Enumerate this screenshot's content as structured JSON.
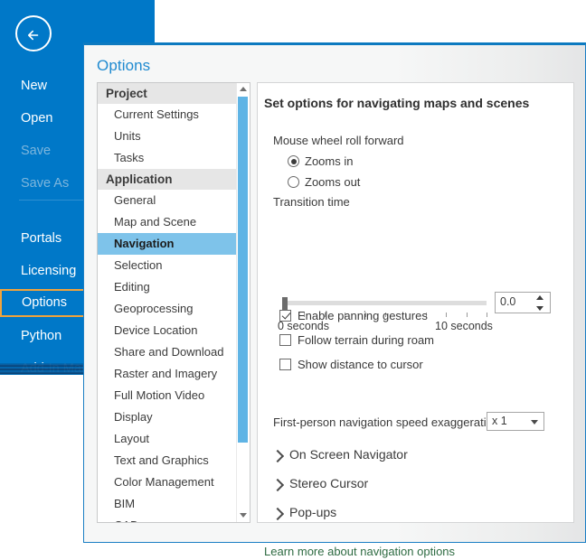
{
  "backstage": {
    "back_icon": "back-arrow-icon",
    "items": [
      {
        "label": "New",
        "state": "enabled"
      },
      {
        "label": "Open",
        "state": "enabled"
      },
      {
        "label": "Save",
        "state": "disabled"
      },
      {
        "label": "Save As",
        "state": "disabled"
      },
      {
        "label": "Portals",
        "state": "enabled"
      },
      {
        "label": "Licensing",
        "state": "enabled"
      },
      {
        "label": "Options",
        "state": "selected"
      },
      {
        "label": "Python",
        "state": "enabled"
      },
      {
        "label": "Add-In Man",
        "state": "enabled"
      }
    ],
    "selection_outline_color": "#f0a33c",
    "panel_color": "#0078c8"
  },
  "dialog": {
    "title": "Options",
    "accent_color": "#1f8ad0",
    "categories": [
      {
        "label": "Project",
        "type": "group"
      },
      {
        "label": "Current Settings",
        "type": "item"
      },
      {
        "label": "Units",
        "type": "item"
      },
      {
        "label": "Tasks",
        "type": "item"
      },
      {
        "label": "Application",
        "type": "group"
      },
      {
        "label": "General",
        "type": "item"
      },
      {
        "label": "Map and Scene",
        "type": "item"
      },
      {
        "label": "Navigation",
        "type": "item",
        "selected": true
      },
      {
        "label": "Selection",
        "type": "item"
      },
      {
        "label": "Editing",
        "type": "item"
      },
      {
        "label": "Geoprocessing",
        "type": "item"
      },
      {
        "label": "Device Location",
        "type": "item"
      },
      {
        "label": "Share and Download",
        "type": "item"
      },
      {
        "label": "Raster and Imagery",
        "type": "item"
      },
      {
        "label": "Full Motion Video",
        "type": "item"
      },
      {
        "label": "Display",
        "type": "item"
      },
      {
        "label": "Layout",
        "type": "item"
      },
      {
        "label": "Text and Graphics",
        "type": "item"
      },
      {
        "label": "Color Management",
        "type": "item"
      },
      {
        "label": "BIM",
        "type": "item"
      },
      {
        "label": "CAD",
        "type": "item"
      }
    ],
    "scrollbar": {
      "up_icon": "scroll-up-arrow-icon",
      "down_icon": "scroll-down-arrow-icon",
      "thumb_color": "#5fb4e5"
    }
  },
  "content": {
    "heading": "Set options for navigating maps and scenes",
    "mouse_wheel_label": "Mouse wheel roll forward",
    "radios": [
      {
        "label": "Zooms in",
        "checked": true
      },
      {
        "label": "Zooms out",
        "checked": false
      }
    ],
    "transition_time": {
      "label": "Transition time",
      "value": "0.0",
      "min_label": "0 seconds",
      "max_label": "10 seconds",
      "slider_position_percent": 0,
      "tick_count": 11
    },
    "checkboxes": [
      {
        "label": "Enable panning gestures",
        "checked": true
      },
      {
        "label": "Follow terrain during roam",
        "checked": false
      },
      {
        "label": "Show distance to cursor",
        "checked": false
      }
    ],
    "speed_exaggeration": {
      "label": "First-person navigation speed exaggeration",
      "value": "x 1"
    },
    "expanders": [
      {
        "label": "On Screen Navigator",
        "expanded": false
      },
      {
        "label": "Stereo Cursor",
        "expanded": false
      },
      {
        "label": "Pop-ups",
        "expanded": false
      }
    ],
    "learn_more_link": "Learn more about navigation options",
    "learn_more_color": "#2e6b42"
  }
}
